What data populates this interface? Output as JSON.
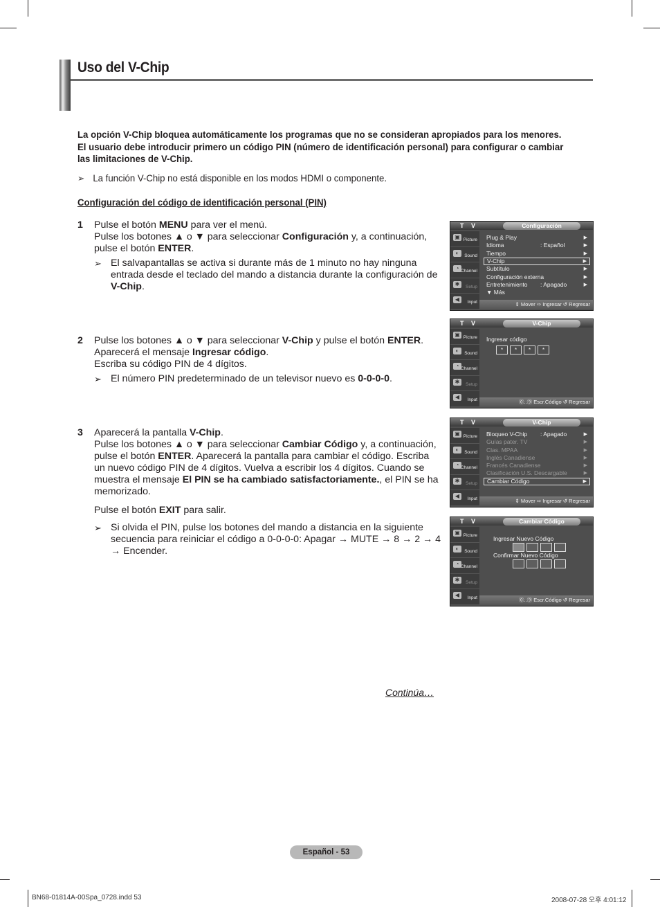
{
  "page": {
    "title": "Uso del V-Chip",
    "intro": [
      "La opción V-Chip bloquea automáticamente los programas que no se consideran apropiados para los menores.",
      "El usuario debe introducir primero un código PIN (número de identificación personal) para configurar o cambiar",
      "las limitaciones de V-Chip."
    ],
    "note_hdmi": "La función V-Chip no está disponible en los modos HDMI o componente.",
    "subheading": "Configuración del código de identificación personal (PIN)",
    "arrow_glyph": "➢",
    "steps": [
      {
        "num": "1",
        "lines": [
          [
            "Pulse el botón ",
            "MENU",
            " para ver el menú."
          ],
          [
            "Pulse los botones ▲ o ▼ para seleccionar ",
            "Configuración",
            " y, a continuación,"
          ],
          [
            "pulse el botón ",
            "ENTER",
            "."
          ]
        ],
        "note": [
          [
            "El salvapantallas se activa si durante más de 1 minuto no hay ninguna",
            "",
            ""
          ],
          [
            "entrada desde el teclado del mando a distancia durante la configuración de",
            "",
            ""
          ],
          [
            "",
            "V-Chip",
            "."
          ]
        ]
      },
      {
        "num": "2",
        "lines": [
          [
            "Pulse los botones ▲ o ▼ para seleccionar ",
            "V-Chip",
            " y pulse el botón ",
            "ENTER",
            "."
          ],
          [
            "Aparecerá el mensaje ",
            "Ingresar código",
            "."
          ],
          [
            "Escriba su código PIN de 4 dígitos.",
            "",
            ""
          ]
        ],
        "note": [
          [
            "El número PIN predeterminado de un televisor nuevo es ",
            "0-0-0-0",
            "."
          ]
        ]
      },
      {
        "num": "3",
        "lines": [
          [
            "Aparecerá la pantalla ",
            "V-Chip",
            "."
          ],
          [
            "Pulse los botones ▲ o ▼ para seleccionar ",
            "Cambiar Código",
            " y, a continuación,"
          ],
          [
            "pulse el botón ",
            "ENTER",
            ". Aparecerá la pantalla para cambiar el código. Escriba"
          ],
          [
            "un nuevo código PIN de 4 dígitos. Vuelva a escribir los 4 dígitos. Cuando se",
            "",
            ""
          ],
          [
            "muestra el mensaje ",
            "El PIN se ha cambiado satisfactoriamente.",
            ", el PIN se ha"
          ],
          [
            "memorizado.",
            "",
            ""
          ]
        ],
        "exit_line": [
          "Pulse el botón ",
          "EXIT",
          " para salir."
        ],
        "note": [
          [
            "Si olvida el PIN, pulse los botones del mando a distancia en la siguiente",
            "",
            ""
          ],
          [
            "secuencia para reiniciar el código a 0-0-0-0: Apagar → MUTE → 8 → 2 → 4",
            "",
            ""
          ],
          [
            "→ Encender.",
            "",
            ""
          ]
        ]
      }
    ],
    "continua": "Continúa…",
    "page_badge": "Español - 53",
    "footer_left": "BN68-01814A-00Spa_0728.indd   53",
    "footer_right": "2008-07-28   오후 4:01:12"
  },
  "tv_common": {
    "tv_label": "T V",
    "sidebar": [
      {
        "label": "Picture",
        "icon": "picture-icon",
        "glyph": "▣"
      },
      {
        "label": "Sound",
        "icon": "sound-icon",
        "glyph": "◐"
      },
      {
        "label": "Channel",
        "icon": "channel-icon",
        "glyph": "◔"
      },
      {
        "label": "Setup",
        "icon": "setup-icon",
        "glyph": "✱"
      },
      {
        "label": "Input",
        "icon": "input-icon",
        "glyph": "◀"
      }
    ]
  },
  "screens": [
    {
      "title": "Configuración",
      "rows": [
        {
          "label": "Plug & Play",
          "value": "",
          "state": "normal"
        },
        {
          "label": "Idioma",
          "value": ": Español",
          "state": "normal"
        },
        {
          "label": "Tiempo",
          "value": "",
          "state": "normal"
        },
        {
          "label": "V-Chip",
          "value": "",
          "state": "selected"
        },
        {
          "label": "Subtítulo",
          "value": "",
          "state": "normal"
        },
        {
          "label": "Configuración externa",
          "value": "",
          "state": "normal"
        },
        {
          "label": "Entretenimiento",
          "value": ": Apagado",
          "state": "normal"
        },
        {
          "label": "▼ Más",
          "value": "",
          "state": "more"
        }
      ],
      "bottom": "⇕ Mover  ⇨ Ingresar  ↺ Regresar"
    },
    {
      "title": "V-Chip",
      "prompt": "Ingresar código",
      "code": [
        "*",
        "*",
        "*",
        "*"
      ],
      "bottom": "⓪..⑨ Escr.Código      ↺ Regresar"
    },
    {
      "title": "V-Chip",
      "rows": [
        {
          "label": "Bloqueo V-Chip",
          "value": ": Apagado",
          "state": "normal"
        },
        {
          "label": "Guías pater. TV",
          "value": "",
          "state": "dim"
        },
        {
          "label": "Clas. MPAA",
          "value": "",
          "state": "dim"
        },
        {
          "label": "Inglés Canadiense",
          "value": "",
          "state": "dim"
        },
        {
          "label": "Francés Canadiense",
          "value": "",
          "state": "dim"
        },
        {
          "label": "Clasificación U.S. Descargable",
          "value": "",
          "state": "dim"
        },
        {
          "label": "Cambiar Código",
          "value": "",
          "state": "selected"
        }
      ],
      "bottom": "⇕ Mover  ⇨ Ingresar  ↺ Regresar"
    },
    {
      "title": "Cambiar Código",
      "prompt_new": "Ingresar Nuevo Código",
      "prompt_confirm": "Confirmar Nuevo Código",
      "bottom": "⓪..⑨ Escr.Código    ↺ Regresar"
    }
  ],
  "colors": {
    "text": "#231f20",
    "title_rule": "#6d6d6d",
    "tv_bg": "#4e4e4e",
    "tv_sidebar": "#3c3c3c",
    "page_badge": "#b8b8b8"
  }
}
